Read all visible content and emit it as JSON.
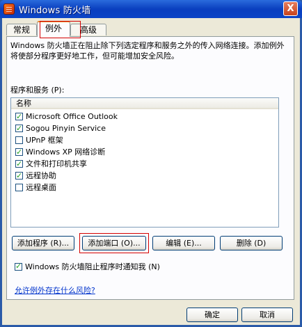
{
  "window": {
    "title": "Windows 防火墙",
    "close_label": "X"
  },
  "tabs": [
    {
      "label": "常规",
      "active": false
    },
    {
      "label": "例外",
      "active": true
    },
    {
      "label": "高级",
      "active": false
    }
  ],
  "description": "Windows 防火墙正在阻止除下列选定程序和服务之外的传入网络连接。添加例外将使部分程序更好地工作，但可能增加安全风险。",
  "programs_label": "程序和服务 (P):",
  "list": {
    "column_header": "名称",
    "items": [
      {
        "label": "Microsoft Office Outlook",
        "checked": true
      },
      {
        "label": "Sogou Pinyin Service",
        "checked": true
      },
      {
        "label": "UPnP 框架",
        "checked": false
      },
      {
        "label": "Windows XP 网络诊断",
        "checked": true
      },
      {
        "label": "文件和打印机共享",
        "checked": true
      },
      {
        "label": "远程协助",
        "checked": true
      },
      {
        "label": "远程桌面",
        "checked": false
      }
    ]
  },
  "buttons": {
    "add_program": "添加程序 (R)...",
    "add_port": "添加端口 (O)...",
    "edit": "编辑 (E)...",
    "delete": "删除 (D)",
    "ok": "确定",
    "cancel": "取消"
  },
  "notify": {
    "label": "Windows 防火墙阻止程序时通知我 (N)",
    "checked": true
  },
  "risk_link": "允许例外存在什么风险?"
}
